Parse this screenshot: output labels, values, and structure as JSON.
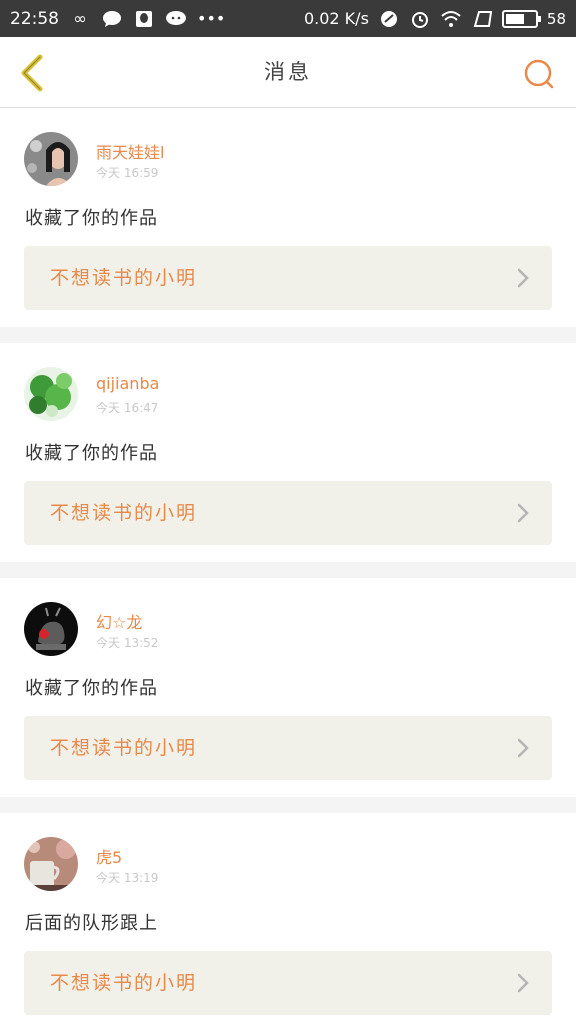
{
  "status_bar": {
    "time": "22:58",
    "speed": "0.02 K/s",
    "battery_level": "58"
  },
  "nav": {
    "title": "消息",
    "back_icon": "chevron-left-icon",
    "search_icon": "search-icon"
  },
  "colors": {
    "accent": "#e8894a",
    "back_icon": "#d9c233",
    "work_box_bg": "#f2f1e9"
  },
  "feed": {
    "items": [
      {
        "username": "雨天娃娃l",
        "time": "今天 16:59",
        "action": "收藏了你的作品",
        "work_title": "不想读书的小明"
      },
      {
        "username": "qijianba",
        "time": "今天 16:47",
        "action": "收藏了你的作品",
        "work_title": "不想读书的小明"
      },
      {
        "username": "幻☆龙",
        "time": "今天 13:52",
        "action": "收藏了你的作品",
        "work_title": "不想读书的小明"
      },
      {
        "username": "虎5",
        "time": "今天 13:19",
        "action": "后面的队形跟上",
        "work_title": "不想读书的小明"
      }
    ]
  }
}
